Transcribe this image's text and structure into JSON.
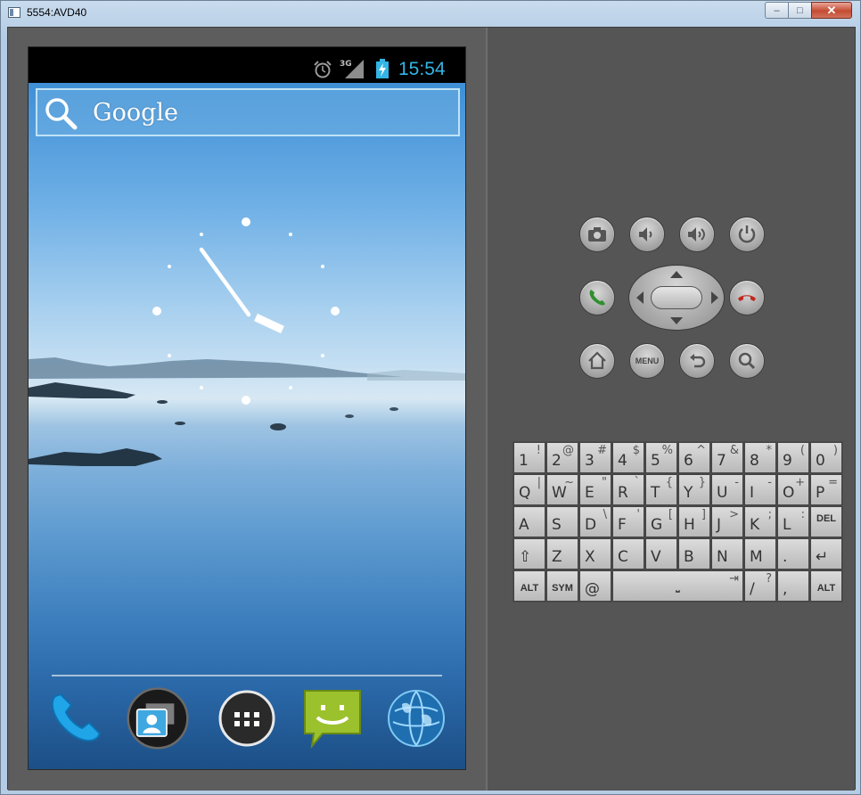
{
  "window": {
    "title": "5554:AVD40",
    "min": "–",
    "max": "□",
    "close": "✕"
  },
  "status": {
    "time": "15:54",
    "network": "3G"
  },
  "search": {
    "label": "Google"
  },
  "dock": {
    "items": [
      "phone",
      "contacts",
      "apps",
      "messaging",
      "browser"
    ]
  },
  "controls": {
    "menu_label": "MENU"
  },
  "keyboard": {
    "rows": [
      [
        {
          "k": "1",
          "a": "!"
        },
        {
          "k": "2",
          "a": "@"
        },
        {
          "k": "3",
          "a": "#"
        },
        {
          "k": "4",
          "a": "$"
        },
        {
          "k": "5",
          "a": "%"
        },
        {
          "k": "6",
          "a": "^"
        },
        {
          "k": "7",
          "a": "&"
        },
        {
          "k": "8",
          "a": "*"
        },
        {
          "k": "9",
          "a": "("
        },
        {
          "k": "0",
          "a": ")"
        }
      ],
      [
        {
          "k": "Q",
          "a": "|"
        },
        {
          "k": "W",
          "a": "~"
        },
        {
          "k": "E",
          "a": "\""
        },
        {
          "k": "R",
          "a": "`"
        },
        {
          "k": "T",
          "a": "{"
        },
        {
          "k": "Y",
          "a": "}"
        },
        {
          "k": "U",
          "a": "-"
        },
        {
          "k": "I",
          "a": "-"
        },
        {
          "k": "O",
          "a": "+"
        },
        {
          "k": "P",
          "a": "="
        }
      ],
      [
        {
          "k": "A",
          "a": ""
        },
        {
          "k": "S",
          "a": ""
        },
        {
          "k": "D",
          "a": "\\"
        },
        {
          "k": "F",
          "a": "'"
        },
        {
          "k": "G",
          "a": "["
        },
        {
          "k": "H",
          "a": "]"
        },
        {
          "k": "J",
          "a": ">"
        },
        {
          "k": "K",
          "a": ";"
        },
        {
          "k": "L",
          "a": ":"
        },
        {
          "k": "DEL",
          "a": ""
        }
      ],
      [
        {
          "k": "⇧",
          "a": ""
        },
        {
          "k": "Z",
          "a": ""
        },
        {
          "k": "X",
          "a": ""
        },
        {
          "k": "C",
          "a": ""
        },
        {
          "k": "V",
          "a": ""
        },
        {
          "k": "B",
          "a": ""
        },
        {
          "k": "N",
          "a": ""
        },
        {
          "k": "M",
          "a": ""
        },
        {
          "k": ".",
          "a": ""
        },
        {
          "k": "↵",
          "a": ""
        }
      ]
    ],
    "bottom": {
      "alt": "ALT",
      "sym": "SYM",
      "at": "@",
      "space": "⎵",
      "tab": "⇥",
      "slash": "/",
      "question": "?",
      "comma": ",",
      "alt2": "ALT"
    }
  }
}
